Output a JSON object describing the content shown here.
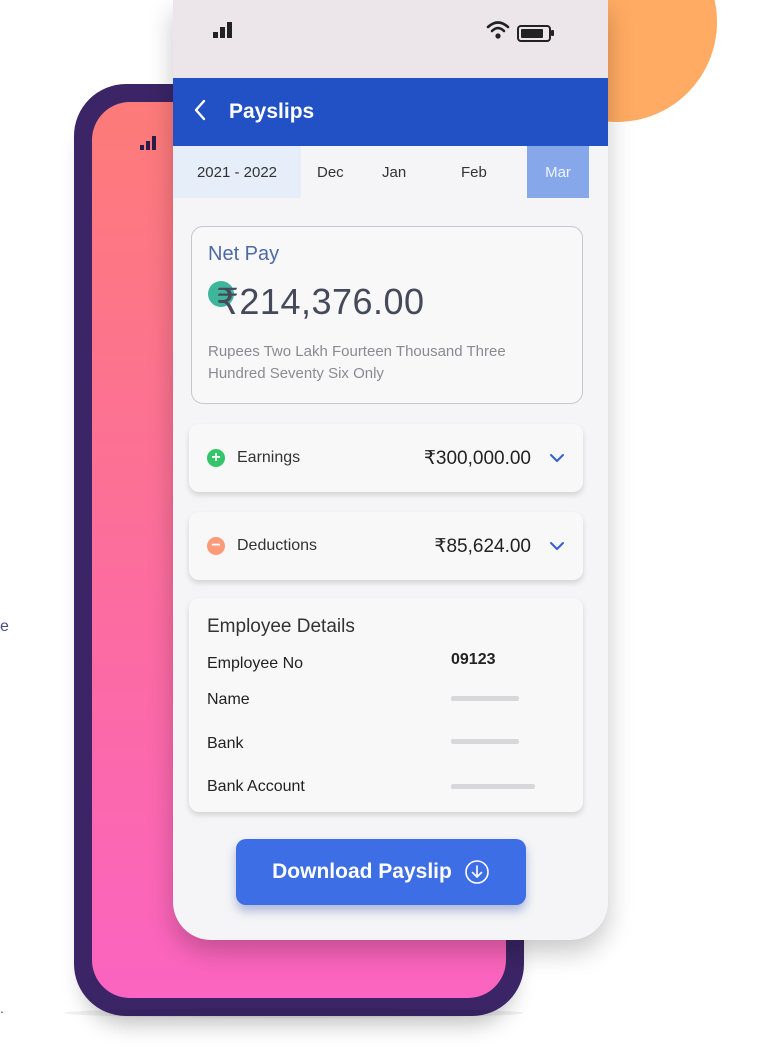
{
  "colors": {
    "header_blue": "#2251c6",
    "active_tab": "#86a8ea",
    "orange_accent": "#ffab63",
    "phone_frame": "#3b2566",
    "earnings_green": "#34c56a",
    "deductions_orange": "#ff9a7a",
    "button_blue": "#3d6ee6"
  },
  "header": {
    "title": "Payslips",
    "back_icon": "chevron-left-icon"
  },
  "tabs": {
    "year": "2021 - 2022",
    "months": [
      "Dec",
      "Jan",
      "Feb"
    ],
    "active_month": "Mar"
  },
  "net_pay": {
    "label": "Net Pay",
    "amount": "₹214,376.00",
    "amount_words": "Rupees Two Lakh Fourteen Thousand Three Hundred Seventy Six Only"
  },
  "earnings": {
    "label": "Earnings",
    "amount": "₹300,000.00",
    "icon": "plus-icon"
  },
  "deductions": {
    "label": "Deductions",
    "amount": "₹85,624.00",
    "icon": "minus-icon"
  },
  "employee_details": {
    "title": "Employee Details",
    "rows": [
      {
        "label": "Employee No",
        "value": "09123"
      },
      {
        "label": "Name"
      },
      {
        "label": "Bank"
      },
      {
        "label": "Bank Account"
      }
    ]
  },
  "download_button": {
    "label": "Download Payslip",
    "icon": "download-icon"
  }
}
